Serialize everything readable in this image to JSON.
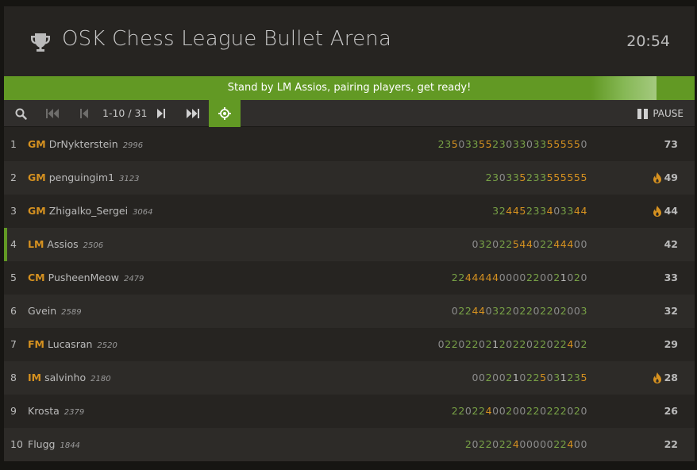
{
  "header": {
    "title": "OSK Chess League Bullet Arena",
    "clock": "20:54"
  },
  "banner": {
    "text": "Stand by LM Assios, pairing players, get ready!",
    "progress": 0.945
  },
  "controls": {
    "pager": "1-10 / 31",
    "pause_label": "PAUSE"
  },
  "colors": {
    "accent_green": "#629924",
    "title_gold": "#d59120"
  },
  "standings": [
    {
      "rank": "1",
      "title": "GM",
      "name": "DrNykterstein",
      "rating": "2996",
      "sheet": "2350335523033033555550",
      "total": "73",
      "fire": false
    },
    {
      "rank": "2",
      "title": "GM",
      "name": "penguingim1",
      "rating": "3123",
      "sheet": "230335233555555",
      "total": "49",
      "fire": true
    },
    {
      "rank": "3",
      "title": "GM",
      "name": "Zhigalko_Sergei",
      "rating": "3064",
      "sheet": "3244523340334 4",
      "total": "44",
      "fire": true
    },
    {
      "rank": "4",
      "title": "LM",
      "name": "Assios",
      "rating": "2506",
      "sheet": "03202254402244400",
      "total": "42",
      "fire": false,
      "me": true
    },
    {
      "rank": "5",
      "title": "CM",
      "name": "PusheenMeow",
      "rating": "2479",
      "sheet": "22444440000220021020",
      "total": "33",
      "fire": false
    },
    {
      "rank": "6",
      "title": "",
      "name": "Gvein",
      "rating": "2589",
      "sheet": "022440322022022020 03",
      "total": "32",
      "fire": false
    },
    {
      "rank": "7",
      "title": "FM",
      "name": "Lucasran",
      "rating": "2520",
      "sheet": "02202202120220220224 02",
      "total": "29",
      "fire": false
    },
    {
      "rank": "8",
      "title": "IM",
      "name": "salvinho",
      "rating": "2180",
      "sheet": "0020021022503123 5",
      "total": "28",
      "fire": true
    },
    {
      "rank": "9",
      "title": "",
      "name": "Krosta",
      "rating": "2379",
      "sheet": "2202240020022022 2020",
      "total": "26",
      "fire": false
    },
    {
      "rank": "10",
      "title": "",
      "name": "Flugg",
      "rating": "1844",
      "sheet": "2022022400000224 00",
      "total": "22",
      "fire": false
    }
  ]
}
